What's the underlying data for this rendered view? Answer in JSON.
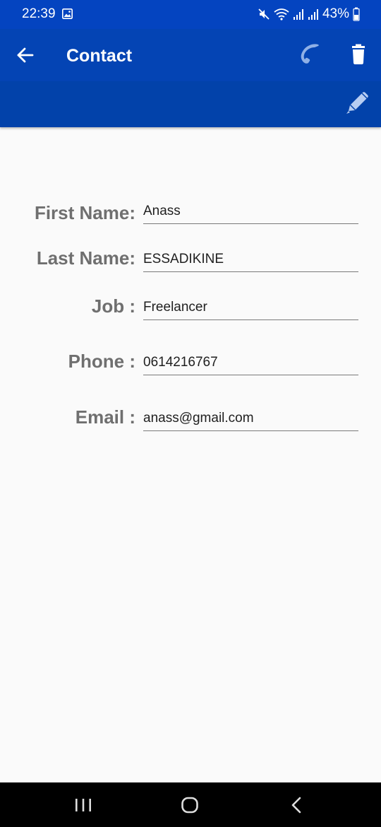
{
  "status_bar": {
    "time": "22:39",
    "battery": "43%",
    "icons": [
      "gallery-icon",
      "mute-icon",
      "wifi-icon",
      "signal-icon",
      "signal-icon",
      "battery-icon"
    ]
  },
  "app_bar": {
    "title": "Contact",
    "back_icon": "arrow-left-icon",
    "call_icon": "phone-icon",
    "delete_icon": "trash-icon",
    "edit_icon": "pencil-icon"
  },
  "form": {
    "first_name": {
      "label": "First Name:",
      "value": "Anass"
    },
    "last_name": {
      "label": "Last Name:",
      "value": "ESSADIKINE"
    },
    "job": {
      "label": "Job :",
      "value": "Freelancer"
    },
    "phone": {
      "label": "Phone :",
      "value": "0614216767"
    },
    "email": {
      "label": "Email :",
      "value": "anass@gmail.com"
    }
  },
  "nav_bar": {
    "icons": [
      "recents-icon",
      "home-icon",
      "back-icon"
    ]
  },
  "colors": {
    "status_bar": "#0444c0",
    "app_bar": "#0444b4",
    "sub_bar": "#0242aa",
    "background": "#fafafa",
    "label": "#6f6f6f",
    "call_icon": "#8fb0e6"
  }
}
